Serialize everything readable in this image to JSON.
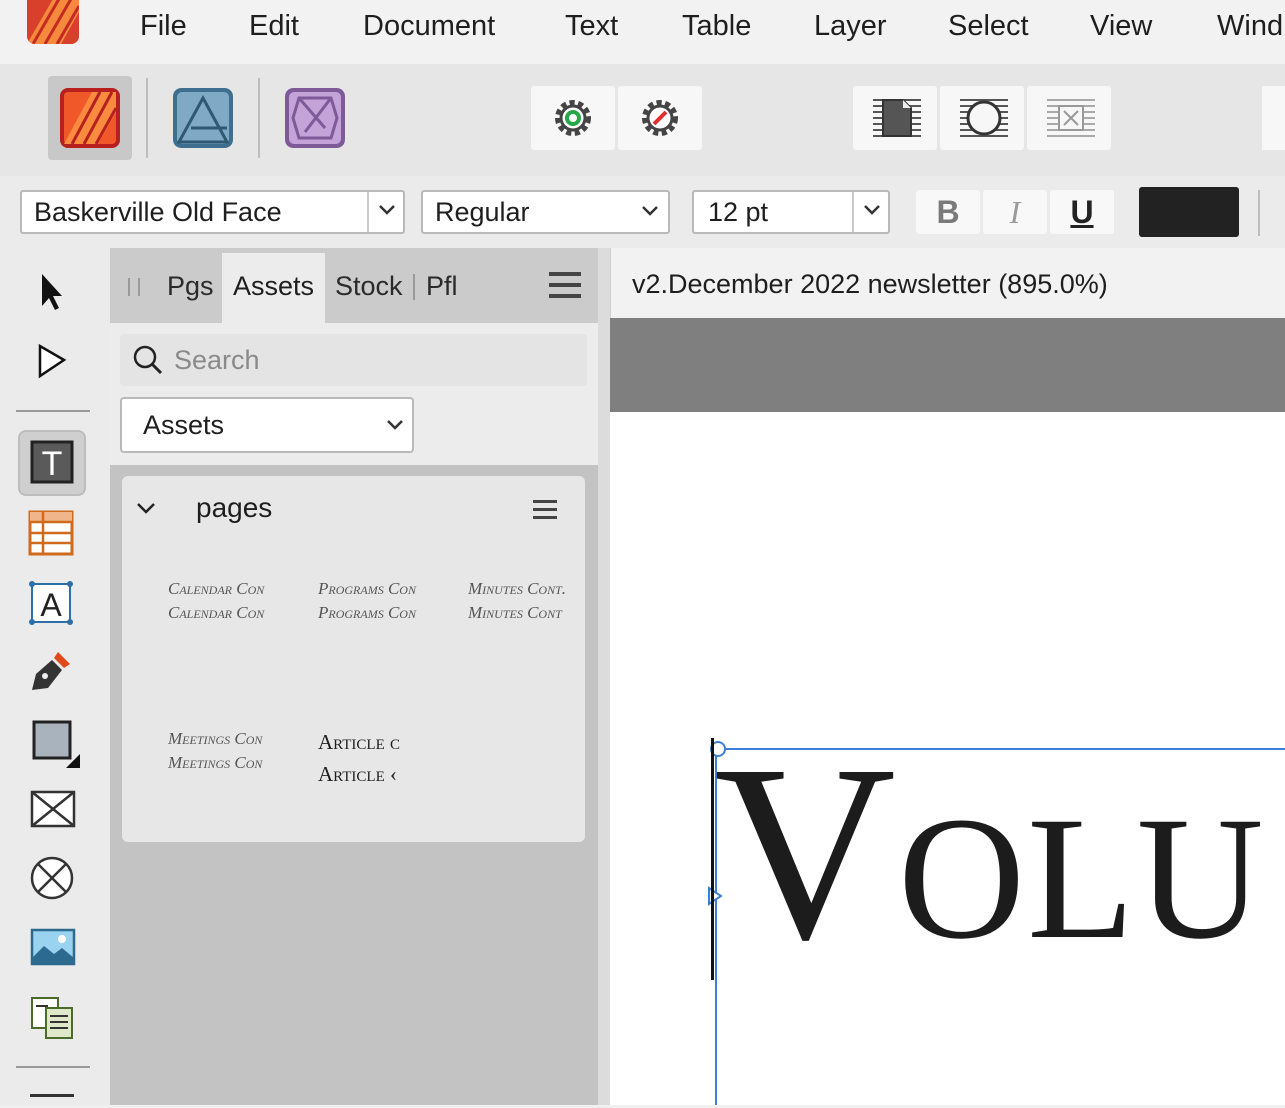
{
  "menubar": {
    "items": [
      "File",
      "Edit",
      "Document",
      "Text",
      "Table",
      "Layer",
      "Select",
      "View",
      "Wind"
    ]
  },
  "context_bar": {
    "font_family": "Baskerville Old Face",
    "font_style": "Regular",
    "font_size": "12 pt",
    "bold_label": "B",
    "italic_label": "I",
    "underline_label": "U",
    "text_color": "#222222"
  },
  "panel": {
    "tabs": [
      "Pgs",
      "Assets",
      "Stock",
      "Pfl"
    ],
    "active_tab": "Assets",
    "search_placeholder": "Search",
    "category_select": "Assets",
    "section_title": "pages",
    "assets": [
      {
        "lines": [
          "Calendar Con",
          "Calendar Con"
        ]
      },
      {
        "lines": [
          "Programs Con",
          "Programs Con"
        ]
      },
      {
        "lines": [
          "Minutes Cont.",
          "Minutes Cont"
        ]
      },
      {
        "lines": [
          "Meetings Con",
          "Meetings Con"
        ]
      },
      {
        "lines": [
          "Article c",
          "Article ‹"
        ]
      }
    ]
  },
  "document": {
    "tab_title": "v2.December 2022 newsletter (895.0%)",
    "page_text": "Volu"
  },
  "colors": {
    "selection": "#3d7fd8",
    "accent_publisher": "#e8473a",
    "accent_designer": "#5b8fb0",
    "accent_photo": "#a07cc0"
  }
}
